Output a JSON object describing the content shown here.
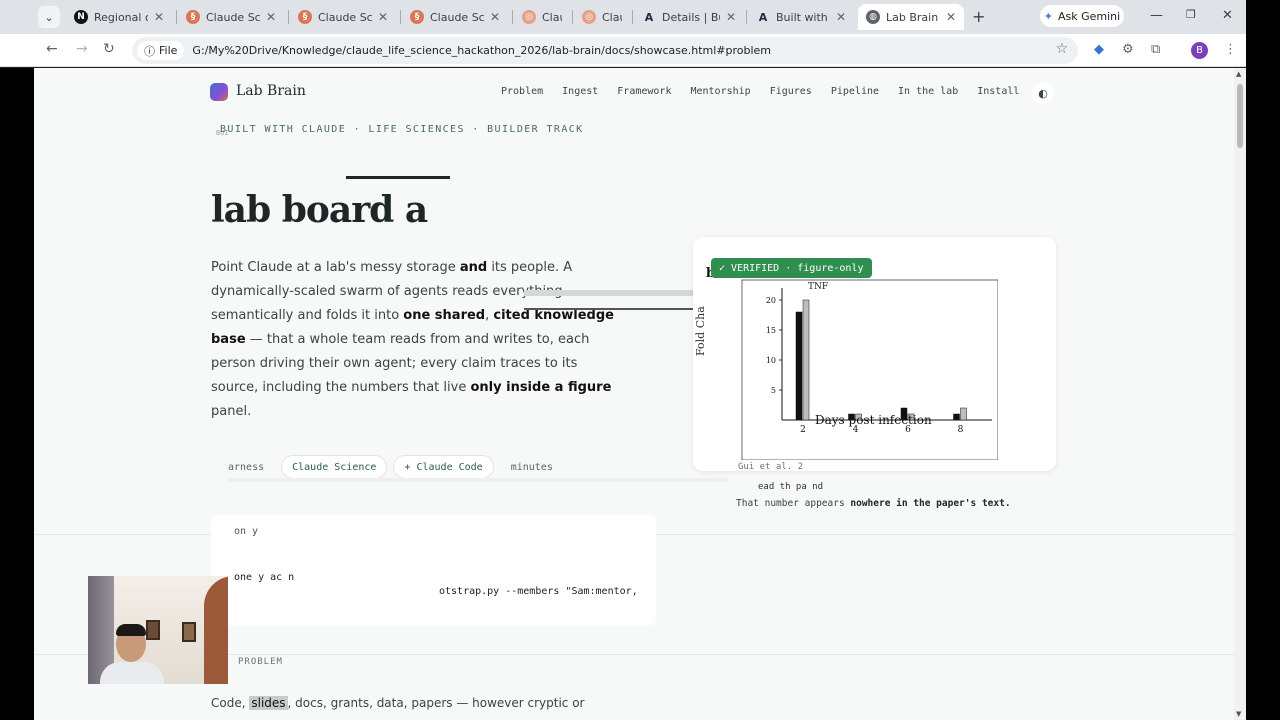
{
  "browser": {
    "tabs": [
      {
        "title": "Regional org",
        "favicon": "N"
      },
      {
        "title": "Claude Scien",
        "favicon": "claude"
      },
      {
        "title": "Claude Scien",
        "favicon": "claude"
      },
      {
        "title": "Claude Scien",
        "favicon": "claude"
      },
      {
        "title": "Claud",
        "favicon": "claude-red"
      },
      {
        "title": "Claud",
        "favicon": "claude-red"
      },
      {
        "title": "Details | Buil",
        "favicon": "A"
      },
      {
        "title": "Built with Cla",
        "favicon": "A"
      },
      {
        "title": "Lab Brain —",
        "favicon": "globe"
      }
    ],
    "ask_gemini": "Ask Gemini",
    "file_badge": "File",
    "url": "G:/My%20Drive/Knowledge/claude_life_science_hackathon_2026/lab-brain/docs/showcase.html#problem",
    "profile_initial": "B"
  },
  "page": {
    "brand": "Lab Brain",
    "nav": [
      "Problem",
      "Ingest",
      "Framework",
      "Mentorship",
      "Figures",
      "Pipeline",
      "In the lab",
      "Install"
    ],
    "kicker": "BUILT WITH CLAUDE · LIFE SCIENCES · BUILDER TRACK",
    "kicker_ghost": "BUI",
    "headline": "lab board a",
    "lede_parts": [
      "Point Claude at a lab's messy storage ",
      "and",
      " its people. A dynamically-scaled swarm of agents reads everything semantically and folds it into ",
      "one shared",
      ", ",
      "cited knowledge base",
      " — that a whole team reads from and writes to, each person driving their own agent; every claim traces to its source, including the numbers that live ",
      "only inside a figure",
      " panel."
    ],
    "pills": [
      "arness",
      "Claude Science",
      "+ Claude Code",
      "minutes"
    ],
    "figure_card": {
      "verified": "✓ VERIFIED · figure-only",
      "panel_letter": "b",
      "title": "TNF",
      "y_label": "Fold Cha",
      "x_label": "Days post infection",
      "citation": "Gui et al. 2",
      "read_line": "ead th  pa        nd",
      "note_plain": "That number appears ",
      "note_bold": "nowhere in the paper's text."
    },
    "code": {
      "line1_prefix": "on    y",
      "line2_prefix": "one y ac  n",
      "command": "otstrap.py --members \"Sam:mentor,"
    },
    "section_kicker": "PROBLEM",
    "bottom_prefix": "Code, ",
    "bottom_highlight": "slides",
    "bottom_rest": ", docs, grants, data, papers — however cryptic or"
  },
  "chart_data": {
    "type": "bar",
    "title": "TNF",
    "xlabel": "Days post infection",
    "ylabel": "Fold Cha",
    "x_ticks": [
      "2",
      "4",
      "6",
      "8"
    ],
    "y_ticks": [
      "5",
      "10",
      "15",
      "20"
    ],
    "ylim": [
      0,
      22
    ],
    "series": [
      {
        "values": [
          18,
          1,
          2,
          1
        ],
        "color": "#111111"
      },
      {
        "values": [
          20,
          1,
          1,
          2
        ],
        "color": "#bdbdbd"
      }
    ]
  }
}
